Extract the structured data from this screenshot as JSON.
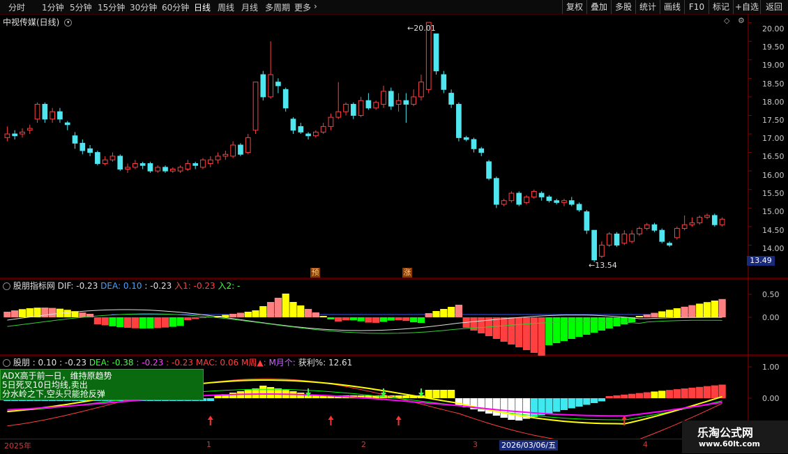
{
  "toolbar": {
    "periods": [
      "分时",
      "1分钟",
      "5分钟",
      "15分钟",
      "30分钟",
      "60分钟",
      "日线",
      "周线",
      "月线",
      "多周期",
      "更多"
    ],
    "active_period": "日线",
    "buttons": [
      "复权",
      "叠加",
      "多股",
      "统计",
      "画线",
      "F10",
      "标记",
      "+自选",
      "返回"
    ]
  },
  "main": {
    "title": "中视传媒(日线)",
    "price_labels": [
      "20.00",
      "19.50",
      "19.00",
      "18.50",
      "18.00",
      "17.50",
      "17.00",
      "16.50",
      "16.00",
      "15.50",
      "15.00",
      "14.50",
      "14.00"
    ],
    "max_label": "20.01",
    "min_label": "13.54",
    "last_price": "13.49",
    "signal_1": "预",
    "signal_2": "涨"
  },
  "panel1": {
    "name": "股朋指标网",
    "dif_label": "DIF: -0.23",
    "dea_label": "DEA: 0.10",
    "val_label": ": -0.23",
    "in1_label": "入1: -0.23",
    "in2_label": "入2: -",
    "y_labels": [
      "0.50",
      "0.00"
    ]
  },
  "panel2": {
    "name": "股朋",
    "v1_label": ": 0.10",
    "v2_label": ": -0.23",
    "dea_label": "DEA: -0.38",
    "v3_label": ": -0.23",
    "v4_label": ": -0.23",
    "mac_label": "MAC: 0.06",
    "week_label": "M周▲:",
    "month_label": "M月个:",
    "profit_label": "获利%: 12.61",
    "y_labels": [
      "1.00",
      "0.00"
    ],
    "notes": [
      "ADX高于前一日，维持原趋势",
      "5日死叉10日均线,卖出",
      "分水岭之下,空头只能抢反弹"
    ]
  },
  "x_axis": {
    "labels": [
      "2025年",
      "1",
      "2",
      "3",
      "4"
    ],
    "cursor_date": "2026/03/06/五"
  },
  "watermark": {
    "line1": "乐淘公式网",
    "line2": "www.60lt.com"
  },
  "colors": {
    "up": "#ff4040",
    "down": "#4fe6f0",
    "frame": "#8b0000",
    "yellow": "#ffff00",
    "green": "#00ff00",
    "pink": "#ff8080",
    "magenta": "#ff00ff",
    "active_tab": "#ffffff"
  },
  "chart_data": {
    "type": "candlestick",
    "y_range": [
      13.35,
      20.2
    ],
    "candles": [
      [
        16.9,
        17.0,
        16.8,
        17.2
      ],
      [
        17.0,
        16.95,
        16.85,
        17.1
      ],
      [
        17.0,
        17.05,
        16.9,
        17.15
      ],
      [
        17.1,
        17.15,
        17.0,
        17.25
      ],
      [
        17.4,
        17.8,
        17.3,
        17.85
      ],
      [
        17.8,
        17.4,
        17.3,
        17.85
      ],
      [
        17.4,
        17.6,
        17.3,
        17.7
      ],
      [
        17.6,
        17.4,
        17.3,
        17.7
      ],
      [
        17.3,
        17.25,
        17.1,
        17.35
      ],
      [
        16.95,
        16.75,
        16.6,
        17.05
      ],
      [
        16.75,
        16.55,
        16.45,
        16.85
      ],
      [
        16.6,
        16.5,
        16.4,
        16.7
      ],
      [
        16.5,
        16.2,
        16.15,
        16.55
      ],
      [
        16.2,
        16.3,
        16.15,
        16.4
      ],
      [
        16.3,
        16.4,
        16.25,
        16.5
      ],
      [
        16.4,
        16.05,
        16.0,
        16.45
      ],
      [
        16.05,
        16.1,
        15.95,
        16.2
      ],
      [
        16.1,
        16.2,
        16.05,
        16.3
      ],
      [
        16.2,
        16.15,
        16.05,
        16.25
      ],
      [
        16.2,
        16.0,
        15.95,
        16.25
      ],
      [
        16.0,
        16.1,
        15.95,
        16.15
      ],
      [
        16.1,
        16.0,
        15.95,
        16.15
      ],
      [
        16.0,
        16.05,
        15.95,
        16.1
      ],
      [
        16.0,
        16.1,
        15.95,
        16.15
      ],
      [
        16.05,
        16.2,
        16.0,
        16.3
      ],
      [
        16.2,
        16.15,
        16.05,
        16.25
      ],
      [
        16.1,
        16.3,
        16.05,
        16.35
      ],
      [
        16.2,
        16.3,
        16.1,
        16.4
      ],
      [
        16.3,
        16.4,
        16.2,
        16.5
      ],
      [
        16.4,
        16.45,
        16.3,
        16.55
      ],
      [
        16.4,
        16.7,
        16.35,
        16.8
      ],
      [
        16.7,
        16.45,
        16.4,
        16.75
      ],
      [
        16.5,
        16.9,
        16.45,
        17.0
      ],
      [
        17.1,
        18.4,
        17.0,
        18.4
      ],
      [
        18.6,
        18.0,
        17.9,
        18.7
      ],
      [
        18.0,
        18.6,
        17.95,
        19.5
      ],
      [
        18.4,
        18.3,
        18.1,
        18.5
      ],
      [
        18.2,
        17.7,
        17.6,
        18.25
      ],
      [
        17.4,
        17.1,
        17.0,
        17.45
      ],
      [
        17.2,
        17.05,
        17.0,
        17.3
      ],
      [
        17.0,
        16.95,
        16.85,
        17.05
      ],
      [
        16.95,
        17.05,
        16.9,
        17.1
      ],
      [
        17.05,
        17.2,
        17.0,
        17.3
      ],
      [
        17.2,
        17.45,
        17.1,
        17.55
      ],
      [
        17.45,
        17.6,
        17.4,
        18.4
      ],
      [
        17.6,
        17.8,
        17.5,
        17.85
      ],
      [
        17.8,
        17.5,
        17.4,
        17.85
      ],
      [
        17.5,
        17.9,
        17.45,
        18.0
      ],
      [
        17.9,
        17.7,
        17.65,
        18.1
      ],
      [
        17.7,
        17.85,
        17.65,
        17.9
      ],
      [
        17.8,
        18.15,
        17.7,
        18.3
      ],
      [
        18.15,
        17.75,
        17.65,
        18.25
      ],
      [
        17.8,
        17.9,
        17.6,
        18.1
      ],
      [
        17.9,
        17.8,
        17.3,
        18.1
      ],
      [
        17.8,
        18.0,
        17.75,
        18.2
      ],
      [
        18.0,
        18.4,
        17.9,
        18.6
      ],
      [
        18.2,
        20.01,
        18.1,
        20.01
      ],
      [
        19.7,
        18.7,
        18.6,
        19.7
      ],
      [
        18.6,
        18.2,
        18.1,
        18.7
      ],
      [
        18.1,
        17.8,
        17.7,
        18.2
      ],
      [
        17.8,
        16.9,
        16.8,
        17.85
      ],
      [
        16.9,
        16.85,
        16.8,
        16.95
      ],
      [
        16.85,
        16.6,
        16.5,
        16.9
      ],
      [
        16.6,
        16.5,
        16.4,
        16.65
      ],
      [
        16.25,
        15.8,
        15.75,
        16.3
      ],
      [
        15.8,
        15.1,
        15.0,
        15.85
      ],
      [
        15.1,
        15.2,
        15.05,
        15.25
      ],
      [
        15.2,
        15.4,
        15.15,
        15.45
      ],
      [
        15.4,
        15.1,
        15.05,
        15.45
      ],
      [
        15.15,
        15.3,
        15.1,
        15.35
      ],
      [
        15.3,
        15.45,
        15.25,
        15.5
      ],
      [
        15.4,
        15.3,
        15.2,
        15.45
      ],
      [
        15.3,
        15.2,
        15.15,
        15.35
      ],
      [
        15.2,
        15.15,
        15.1,
        15.25
      ],
      [
        15.15,
        15.2,
        15.05,
        15.25
      ],
      [
        15.2,
        15.1,
        15.05,
        15.3
      ],
      [
        15.1,
        14.95,
        14.9,
        15.15
      ],
      [
        14.9,
        14.4,
        14.3,
        14.95
      ],
      [
        14.4,
        13.6,
        13.54,
        14.4
      ],
      [
        13.7,
        14.0,
        13.65,
        14.1
      ],
      [
        14.0,
        14.3,
        13.95,
        14.35
      ],
      [
        14.3,
        14.0,
        13.95,
        14.35
      ],
      [
        14.05,
        14.3,
        14.0,
        14.4
      ],
      [
        14.1,
        14.3,
        14.05,
        14.4
      ],
      [
        14.3,
        14.45,
        14.25,
        14.5
      ],
      [
        14.45,
        14.55,
        14.4,
        14.6
      ],
      [
        14.55,
        14.4,
        14.35,
        14.6
      ],
      [
        14.4,
        14.1,
        14.05,
        14.45
      ],
      [
        14.05,
        14.0,
        13.95,
        14.1
      ],
      [
        14.2,
        14.45,
        14.15,
        14.5
      ],
      [
        14.45,
        14.55,
        14.4,
        14.8
      ],
      [
        14.55,
        14.6,
        14.5,
        14.75
      ],
      [
        14.6,
        14.75,
        14.55,
        14.8
      ],
      [
        14.75,
        14.8,
        14.7,
        14.85
      ],
      [
        14.8,
        14.55,
        14.5,
        14.85
      ],
      [
        14.55,
        14.7,
        14.5,
        14.75
      ]
    ]
  }
}
